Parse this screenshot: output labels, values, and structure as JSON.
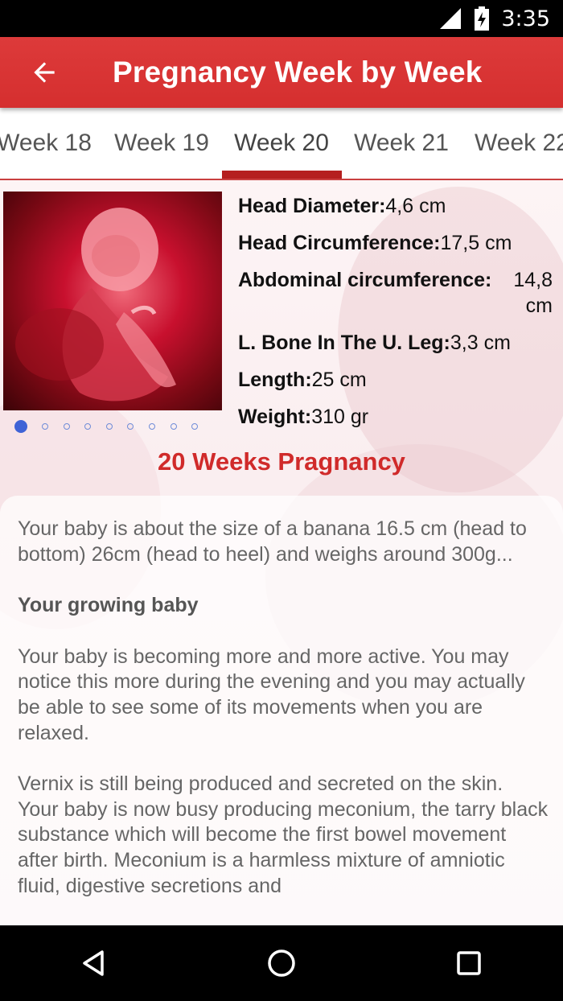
{
  "status_bar": {
    "time": "3:35"
  },
  "app_bar": {
    "title": "Pregnancy Week by Week"
  },
  "tabs": [
    {
      "label": "Week 18"
    },
    {
      "label": "Week 19"
    },
    {
      "label": "Week 20",
      "active": true
    },
    {
      "label": "Week 21"
    },
    {
      "label": "Week 22"
    }
  ],
  "stats": [
    {
      "label": "Head Diameter:",
      "value": "4,6 cm"
    },
    {
      "label": "Head Circumference:",
      "value": "17,5 cm"
    },
    {
      "label": "Abdominal circumference:",
      "value": "14,8 cm"
    },
    {
      "label": "L. Bone In The U. Leg:",
      "value": "3,3 cm"
    },
    {
      "label": "Length:",
      "value": "25 cm"
    },
    {
      "label": "Weight:",
      "value": "310 gr"
    }
  ],
  "pager": {
    "count": 9,
    "active_index": 0
  },
  "section_title": "20 Weeks Pragnancy",
  "article": {
    "intro": "Your baby is about the size of a banana 16.5 cm (head to bottom) 26cm (head to heel) and weighs around 300g...",
    "heading": "Your growing baby",
    "para1": "Your baby is becoming more and more active. You may notice this more during the evening and you may actually be able to see some of its movements when you are relaxed.",
    "para2": "Vernix is still being produced and secreted on the skin. Your baby is now busy producing meconium, the tarry black substance which will become the first bowel movement after birth. Meconium is a harmless mixture of amniotic fluid, digestive secretions and"
  },
  "colors": {
    "app_bar": "#d52f2f",
    "accent": "#b51f1f",
    "title_red": "#d02a2a",
    "dot_blue": "#3f63d6"
  },
  "icons": [
    "back-arrow-icon",
    "signal-icon",
    "battery-charging-icon",
    "nav-back-icon",
    "nav-home-icon",
    "nav-recents-icon"
  ]
}
